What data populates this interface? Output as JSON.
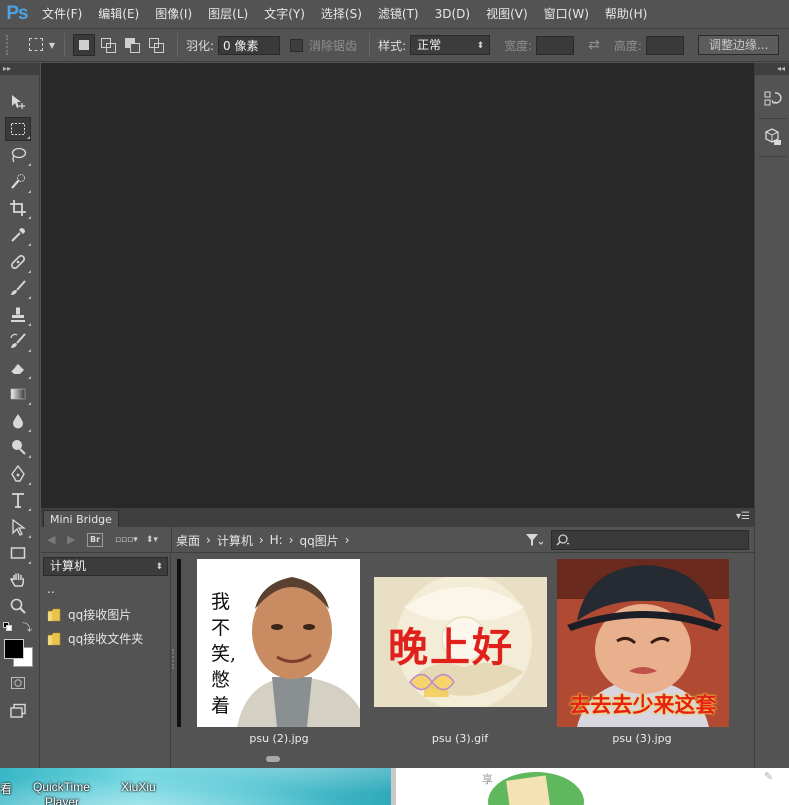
{
  "app": {
    "logo": "Ps"
  },
  "menu": [
    "文件(F)",
    "编辑(E)",
    "图像(I)",
    "图层(L)",
    "文字(Y)",
    "选择(S)",
    "滤镜(T)",
    "3D(D)",
    "视图(V)",
    "窗口(W)",
    "帮助(H)"
  ],
  "options": {
    "feather_label": "羽化:",
    "feather_value": "0 像素",
    "antialias_label": "消除锯齿",
    "style_label": "样式:",
    "style_value": "正常",
    "width_label": "宽度:",
    "height_label": "高度:",
    "refine_edge": "调整边缘..."
  },
  "panel": {
    "tab": "Mini Bridge",
    "br": "Br",
    "breadcrumb": [
      "桌面",
      "计算机",
      "H:",
      "qq图片"
    ],
    "folder_select": "计算机",
    "tree_up": "..",
    "tree": [
      "qq接收图片",
      "qq接收文件夹"
    ]
  },
  "thumbnails": [
    {
      "file": "psu (2).jpg",
      "text": "我不笑,憋着"
    },
    {
      "file": "psu (3).gif",
      "text": "晚上好"
    },
    {
      "file": "psu (3).jpg",
      "text": "去去去少来这套"
    }
  ],
  "taskbar": {
    "item1": "看",
    "item2": "QuickTime",
    "item2b": "Player",
    "item3": "XiuXiu",
    "share": "享"
  },
  "colors": {
    "ui_bg": "#535353",
    "canvas": "#282828",
    "accent": "#4ca3e6",
    "foreground_swatch": "#000000",
    "background_swatch": "#ffffff"
  }
}
